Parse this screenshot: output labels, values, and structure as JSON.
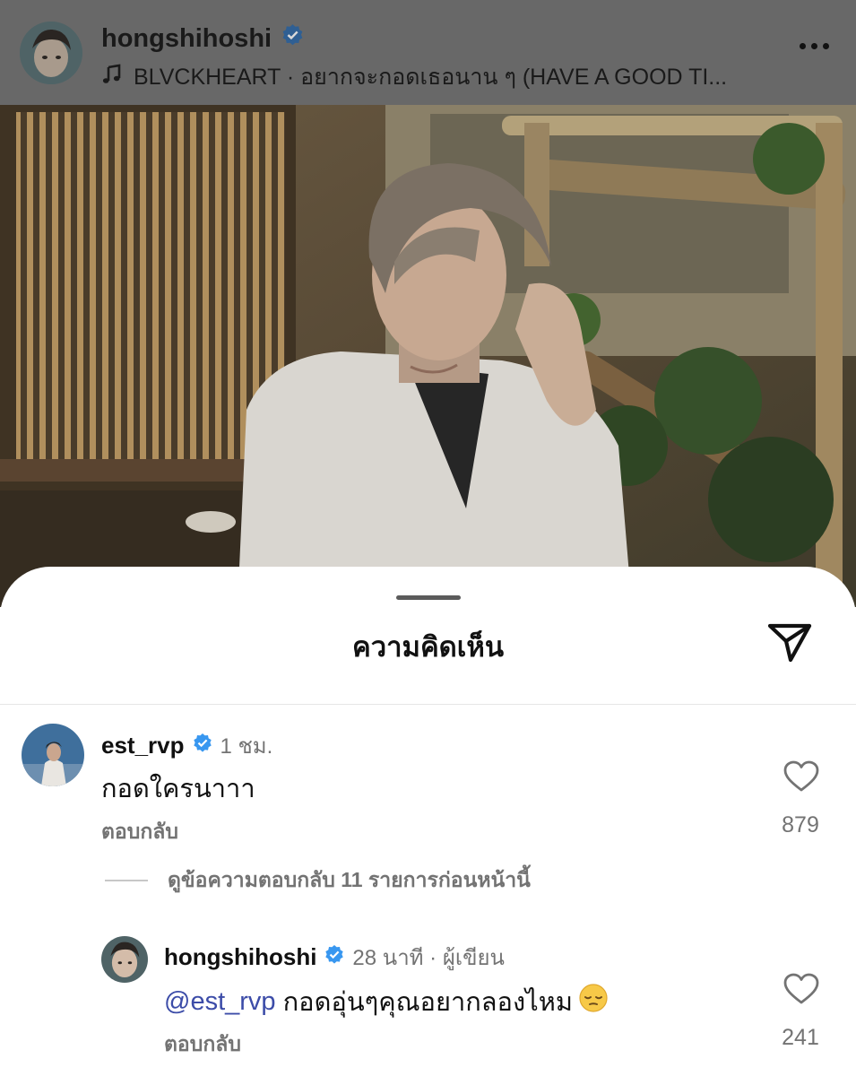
{
  "header": {
    "username": "hongshihoshi",
    "music_line": "BLVCKHEART · อยากจะกอดเธอนาน ๆ (HAVE A GOOD TI..."
  },
  "sheet": {
    "title": "ความคิดเห็น"
  },
  "comments": [
    {
      "username": "est_rvp",
      "time": "1 ชม.",
      "text": "กอดใครนาาา",
      "reply_label": "ตอบกลับ",
      "likes": "879"
    }
  ],
  "view_replies": "ดูข้อความตอบกลับ 11 รายการก่อนหน้านี้",
  "reply": {
    "username": "hongshihoshi",
    "time": "28 นาที · ผู้เขียน",
    "mention": "@est_rvp",
    "text": " กอดอุ่นๆคุณอยากลองไหม",
    "reply_label": "ตอบกลับ",
    "likes": "241"
  },
  "colors": {
    "verified": "#3897f0",
    "mention": "#3c4ca8",
    "muted": "#737373"
  }
}
